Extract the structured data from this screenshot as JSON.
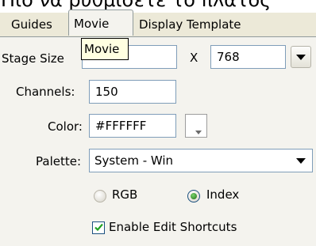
{
  "caption": "Πιο να ρυθμίσετε το πλάτος",
  "tabs": {
    "guides": "Guides",
    "movie": "Movie",
    "display_template": "Display Template"
  },
  "tooltip": "Movie",
  "stage_size": {
    "label": "Stage Size",
    "width_value": "",
    "separator": "X",
    "height_value": "768"
  },
  "channels": {
    "label": "Channels:",
    "value": "150"
  },
  "color": {
    "label": "Color:",
    "value": "#FFFFFF",
    "swatch_color": "#ffffff"
  },
  "palette": {
    "label": "Palette:",
    "selected": "System - Win"
  },
  "color_mode": {
    "rgb_label": "RGB",
    "index_label": "Index",
    "selected": "Index"
  },
  "enable_edit_shortcuts": {
    "label": "Enable Edit Shortcuts",
    "checked": true
  }
}
